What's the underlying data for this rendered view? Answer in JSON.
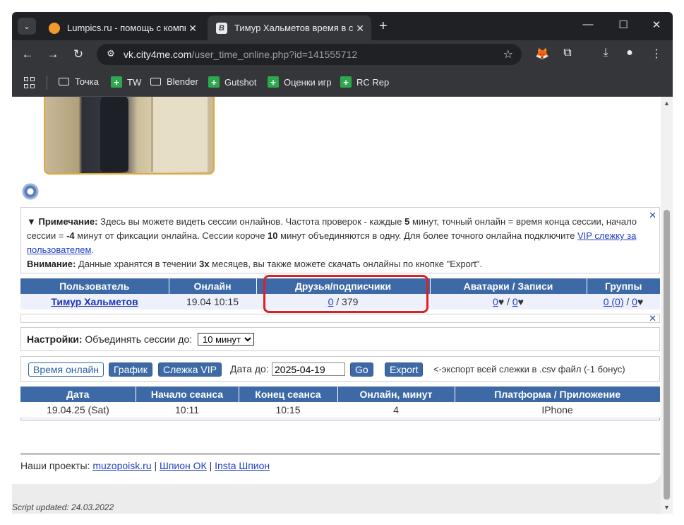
{
  "browser": {
    "tabs": [
      {
        "title": "Lumpics.ru - помощь с компь",
        "active": false
      },
      {
        "title": "Тимур Хальметов время в сет",
        "active": true
      }
    ],
    "url_host": "vk.city4me.com",
    "url_path": "/user_time_online.php?id=141555712",
    "bookmarks": [
      "Точка",
      "TW",
      "Blender",
      "Gutshot",
      "Оценки игр",
      "RC Rep"
    ]
  },
  "note": {
    "prefix": "▼ Примечание:",
    "text1": " Здесь вы можете видеть сессии онлайнов. Частота проверок - каждые ",
    "interval": "5",
    "text2": " минут, точный онлайн = время конца сессии, начало сессии = ",
    "offset": "-4",
    "text3": " минут от фиксации онлайна. Сессии короче ",
    "merge": "10",
    "text4": " минут объединяются в одну. Для более точного онлайна подключите ",
    "vip_link": "VIP слежку за пользователем",
    "period_after_link": ".",
    "warning_label": "Внимание:",
    "warning_text1": " Данные хранятся в течении ",
    "warning_period": "3х",
    "warning_text2": " месяцев, вы также можете скачать онлайны по кнопке \"Export\"."
  },
  "user_table": {
    "headers": [
      "Пользователь",
      "Онлайн",
      "Друзья/подписчики",
      "Аватарки / Записи",
      "Группы"
    ],
    "row": {
      "name": "Тимур Хальметов",
      "online": "19.04 10:15",
      "friends": "0",
      "followers": " / 379",
      "avatars": "0",
      "avatars_heart": "♥ / ",
      "posts": "0",
      "posts_heart": "♥",
      "groups": "0 (0)",
      "groups_sep": " / ",
      "groups2": "0",
      "groups_heart": "♥"
    }
  },
  "settings": {
    "label": "Настройки:",
    "text": " Объединять сессии до: ",
    "selected": "10 минут"
  },
  "controls": {
    "time_online": "Время онлайн",
    "graph": "График",
    "vip": "Слежка VIP",
    "date_label": "Дата до:",
    "date_value": "2025-04-19",
    "go": "Go",
    "export": "Export",
    "export_hint": "<-экспорт всей слежки в .csv файл (-1 бонус)"
  },
  "sessions_table": {
    "headers": [
      "Дата",
      "Начало сеанса",
      "Конец сеанса",
      "Онлайн, минут",
      "Платформа / Приложение"
    ],
    "rows": [
      [
        "19.04.25 (Sat)",
        "10:11",
        "10:15",
        "4",
        "IPhone"
      ]
    ]
  },
  "footer": {
    "label": "Наши проекты: ",
    "links": [
      "muzopoisk.ru",
      "Шпион ОК",
      "Insta Шпион"
    ],
    "sep": " | "
  },
  "script_updated": "Script updated: 24.03.2022"
}
